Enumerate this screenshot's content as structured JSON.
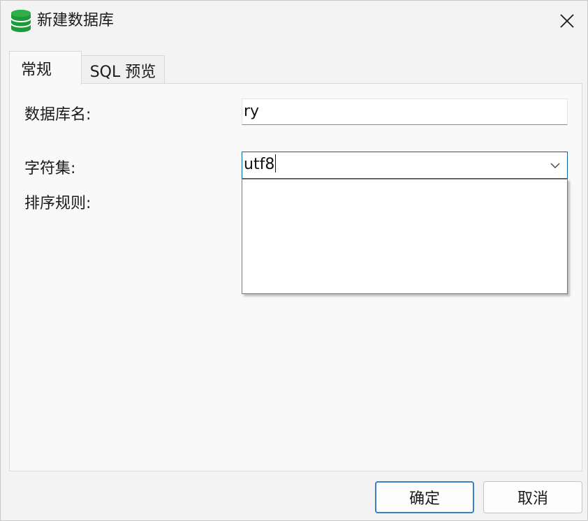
{
  "window": {
    "title": "新建数据库",
    "icon": "database-icon"
  },
  "tabs": [
    {
      "label": "常规",
      "active": true
    },
    {
      "label": "SQL 预览",
      "active": false
    }
  ],
  "form": {
    "db_name_label": "数据库名:",
    "db_name_value": "ry",
    "charset_label": "字符集:",
    "charset_value": "utf8",
    "collation_label": "排序规则:"
  },
  "buttons": {
    "ok": "确定",
    "cancel": "取消"
  },
  "colors": {
    "icon_green": "#1f9a3a",
    "focus_border": "#0a64a4",
    "ok_border": "#3a7ec6"
  }
}
